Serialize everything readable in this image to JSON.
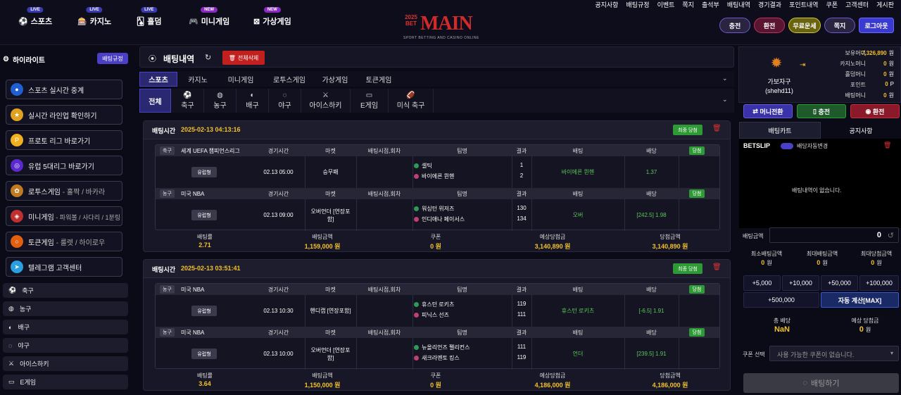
{
  "utility_links": [
    "공지사항",
    "배팅규정",
    "이벤트",
    "쪽지",
    "출석부",
    "배팅내역",
    "경기결과",
    "포인트내역",
    "쿠폰",
    "고객센터",
    "게시판"
  ],
  "nav": [
    {
      "label": "스포츠",
      "badge": "LIVE",
      "icon": "soccer-icon"
    },
    {
      "label": "카지노",
      "badge": "LIVE",
      "icon": "casino-icon"
    },
    {
      "label": "홀덤",
      "badge": "LIVE",
      "icon": "cards-icon"
    },
    {
      "label": "미니게임",
      "badge": "NEW",
      "icon": "gamepad-icon"
    },
    {
      "label": "가상게임",
      "badge": "NEW",
      "icon": "virtual-icon"
    }
  ],
  "logo": {
    "year": "2025",
    "text": "MAIN",
    "bet": "BET",
    "tagline": "SPORT BETTING AND CASINO ONLINE"
  },
  "header_buttons": [
    "충전",
    "환전",
    "무료운세",
    "쪽지",
    "로그아웃"
  ],
  "highlight": {
    "title": "하이라이트",
    "rules_btn": "배팅규정"
  },
  "highlight_items": [
    {
      "label": "스포츠 실시간 중계",
      "sub": "",
      "icon": "live-icon",
      "color": "#1f5fd0"
    },
    {
      "label": "실시간 라인업 확인하기",
      "sub": "",
      "icon": "lineup-icon",
      "color": "#e0a020"
    },
    {
      "label": "프로토 리그 바로가기",
      "sub": "",
      "icon": "proto-icon",
      "color": "#f0b020"
    },
    {
      "label": "유럽 5대리그 바로가기",
      "sub": "",
      "icon": "league-icon",
      "color": "#5a2ad0"
    },
    {
      "label": "로투스게임",
      "sub": " - 홀짝 / 바카라",
      "icon": "lotus-icon",
      "color": "#c07a20"
    },
    {
      "label": "미니게임",
      "sub": " - 파워볼 / 사다리 / 1분링",
      "icon": "minigame-icon",
      "color": "#c03030"
    },
    {
      "label": "토큰게임",
      "sub": " - 룰렛 / 하이로우",
      "icon": "token-icon",
      "color": "#e06010"
    },
    {
      "label": "텔레그램 고객센터",
      "sub": "",
      "icon": "telegram-icon",
      "color": "#2a9fe0"
    }
  ],
  "sports": [
    {
      "label": "축구",
      "icon": "soccer-icon"
    },
    {
      "label": "농구",
      "icon": "basketball-icon"
    },
    {
      "label": "배구",
      "icon": "volleyball-icon"
    },
    {
      "label": "야구",
      "icon": "baseball-icon"
    },
    {
      "label": "아이스하키",
      "icon": "hockey-icon"
    },
    {
      "label": "E게임",
      "icon": "egame-icon"
    }
  ],
  "main": {
    "title": "배팅내역",
    "delete_all": "전체삭제",
    "tabs": [
      "스포츠",
      "카지노",
      "미니게임",
      "로투스게임",
      "가상게임",
      "토큰게임"
    ],
    "sport_tabs": [
      "전체",
      "축구",
      "농구",
      "배구",
      "야구",
      "아이스하키",
      "E게임",
      "미식 축구"
    ]
  },
  "table_headers": [
    "경기시간",
    "마켓",
    "배팅시점,회차",
    "팀명",
    "결과",
    "배팅",
    "배당"
  ],
  "summary_labels": [
    "배팅률",
    "배팅금액",
    "쿠폰",
    "예상당첨금",
    "당첨금액"
  ],
  "bets": [
    {
      "time_label": "배팅시간",
      "time": "2025-02-13 04:13:16",
      "status": "최종 당첨",
      "games": [
        {
          "sport": "축구",
          "league": "세계 UEFA 챔피언스리그",
          "type": "유럽형",
          "time": "02.13 05:00",
          "market": "승무패",
          "teams": [
            "셀틱",
            "바이에른 뮌헨"
          ],
          "scores": [
            "1",
            "2"
          ],
          "pick": "바이에른 뮌헨",
          "odds": "1.37",
          "result": "당첨"
        },
        {
          "sport": "농구",
          "league": "미국 NBA",
          "type": "유럽형",
          "time": "02.13 09:00",
          "market": "오버언더 [연장포함]",
          "teams": [
            "워싱턴 위저즈",
            "인디애나 페이서스"
          ],
          "scores": [
            "130",
            "134"
          ],
          "pick": "오버",
          "odds": "[242.5] 1.98",
          "result": "당첨"
        }
      ],
      "summary": {
        "rate": "2.71",
        "amount": "1,159,000",
        "coupon": "0",
        "expected": "3,140,890",
        "win": "3,140,890",
        "unit": "원"
      }
    },
    {
      "time_label": "배팅시간",
      "time": "2025-02-13 03:51:41",
      "status": "최종 당첨",
      "games": [
        {
          "sport": "농구",
          "league": "미국 NBA",
          "type": "유럽형",
          "time": "02.13 10:30",
          "market": "핸디캡 [연장포함]",
          "teams": [
            "휴스턴 로키츠",
            "피닉스 선즈"
          ],
          "scores": [
            "119",
            "111"
          ],
          "pick": "휴스턴 로키츠",
          "odds": "[-6.5] 1.91",
          "result": "당첨"
        },
        {
          "sport": "농구",
          "league": "미국 NBA",
          "type": "유럽형",
          "time": "02.13 10:00",
          "market": "오버언더 [연장포함]",
          "teams": [
            "뉴올리언즈 펠리컨스",
            "새크라멘토 킹스"
          ],
          "scores": [
            "111",
            "119"
          ],
          "pick": "언더",
          "odds": "[239.5] 1.91",
          "result": "당첨"
        }
      ],
      "summary": {
        "rate": "3.64",
        "amount": "1,150,000",
        "coupon": "0",
        "expected": "4,186,000",
        "win": "4,186,000",
        "unit": "원"
      }
    }
  ],
  "profile": {
    "name": "가보자구",
    "id": "(shehd11)",
    "stats": [
      {
        "label": "보유머니",
        "value": "7,326,890",
        "unit": "원"
      },
      {
        "label": "카지노머니",
        "value": "0",
        "unit": "원"
      },
      {
        "label": "홀덤머니",
        "value": "0",
        "unit": "원"
      },
      {
        "label": "포인트",
        "value": "0",
        "unit": "P"
      },
      {
        "label": "배팅머니",
        "value": "0",
        "unit": "원"
      }
    ],
    "buttons": [
      "머니전환",
      "충전",
      "환전"
    ]
  },
  "betslip": {
    "tabs": [
      "배팅카트",
      "공지사항"
    ],
    "title": "BETSLIP",
    "auto_label": "배당자동변경",
    "empty": "배팅내역이 없습니다.",
    "amount_label": "배팅금액",
    "amount_value": "0",
    "limits": [
      {
        "label": "최소배팅금액",
        "value": "0",
        "unit": "원"
      },
      {
        "label": "최대배팅금액",
        "value": "0",
        "unit": "원"
      },
      {
        "label": "최대당첨금액",
        "value": "0",
        "unit": "원"
      }
    ],
    "amount_buttons": [
      "+5,000",
      "+10,000",
      "+50,000",
      "+100,000",
      "+500,000",
      "자동 계산[MAX]"
    ],
    "total_odds_label": "총 배당",
    "total_odds": "NaN",
    "expected_label": "예상 당첨금",
    "expected_value": "0",
    "expected_unit": "원",
    "coupon_label": "쿠폰 선택",
    "coupon_placeholder": "사용 가능한 쿠폰이 없습니다.",
    "submit": "배팅하기"
  },
  "colors": {
    "accent": "#4b3fc6",
    "gold": "#f3c12a",
    "win_green": "#2e9a36",
    "danger": "#d02020"
  }
}
